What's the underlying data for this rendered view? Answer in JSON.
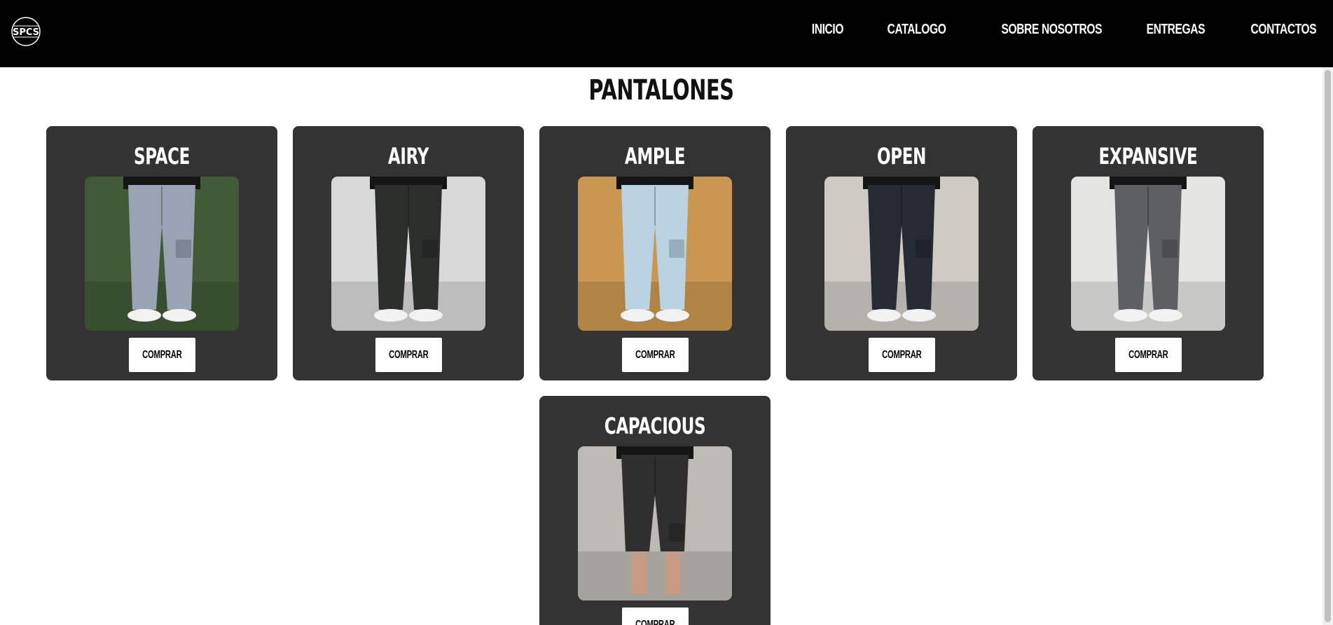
{
  "brand": {
    "logo_text": "SPCS"
  },
  "nav": {
    "items": [
      {
        "label": "INICIO"
      },
      {
        "label": "CATALOGO"
      },
      {
        "label": "SOBRE NOSOTROS"
      },
      {
        "label": "ENTREGAS"
      },
      {
        "label": "CONTACTOS"
      }
    ]
  },
  "page": {
    "title": "PANTALONES"
  },
  "products": [
    {
      "name": "SPACE",
      "button": "COMPRAR",
      "pants_color": "#9aa3b3",
      "bg_color": "#3f5a35"
    },
    {
      "name": "AIRY",
      "button": "COMPRAR",
      "pants_color": "#2b2f2c",
      "bg_color": "#d8d8d8"
    },
    {
      "name": "AMPLE",
      "button": "COMPRAR",
      "pants_color": "#b9d3e2",
      "bg_color": "#c9974f"
    },
    {
      "name": "OPEN",
      "button": "COMPRAR",
      "pants_color": "#262a33",
      "bg_color": "#cfcac4"
    },
    {
      "name": "EXPANSIVE",
      "button": "COMPRAR",
      "pants_color": "#5d5f63",
      "bg_color": "#e4e4e2"
    },
    {
      "name": "CAPACIOUS",
      "button": "COMPRAR",
      "pants_color": "#2f2f2f",
      "bg_color": "#bdb9b4"
    }
  ]
}
